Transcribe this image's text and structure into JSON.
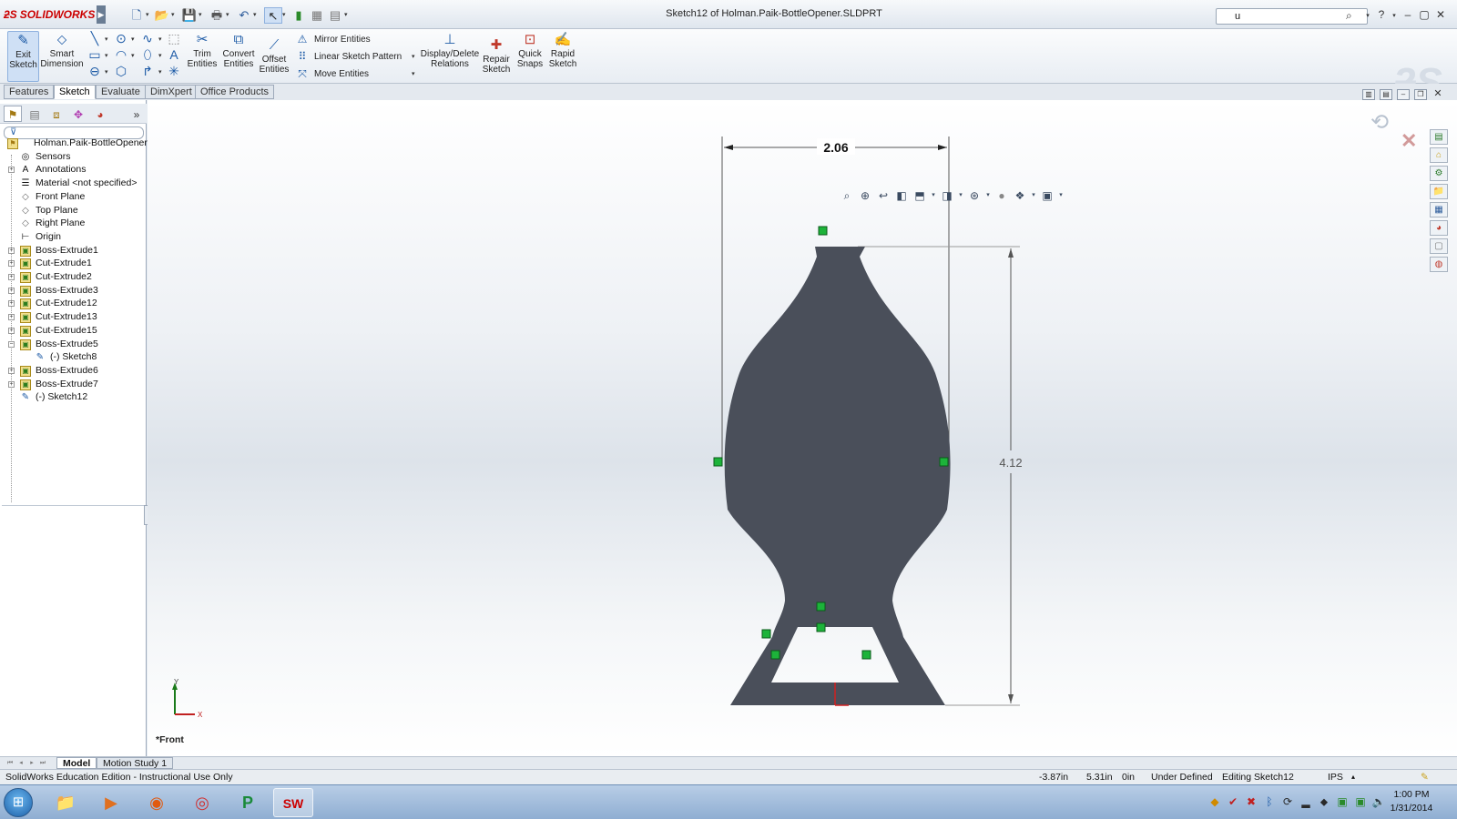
{
  "app": {
    "logo_text": "SOLIDWORKS",
    "doc_title": "Sketch12 of Holman.Paik-BottleOpener.SLDPRT",
    "search_value": "u"
  },
  "commands": {
    "exit_sketch": "Exit Sketch",
    "smart_dimension": "Smart Dimension",
    "trim_entities": "Trim Entities",
    "convert_entities": "Convert Entities",
    "offset_entities": "Offset Entities",
    "mirror_entities": "Mirror Entities",
    "linear_sketch_pattern": "Linear Sketch Pattern",
    "move_entities": "Move Entities",
    "display_delete_relations": "Display/Delete Relations",
    "repair_sketch": "Repair Sketch",
    "quick_snaps": "Quick Snaps",
    "rapid_sketch": "Rapid Sketch"
  },
  "tabs": [
    "Features",
    "Sketch",
    "Evaluate",
    "DimXpert",
    "Office Products"
  ],
  "active_tab": "Sketch",
  "tree": [
    {
      "label": "Holman.Paik-BottleOpener",
      "type": "part"
    },
    {
      "label": "Sensors",
      "type": "sensor"
    },
    {
      "label": "Annotations",
      "type": "annot"
    },
    {
      "label": "Material <not specified>",
      "type": "material"
    },
    {
      "label": "Front Plane",
      "type": "plane"
    },
    {
      "label": "Top Plane",
      "type": "plane"
    },
    {
      "label": "Right Plane",
      "type": "plane"
    },
    {
      "label": "Origin",
      "type": "origin"
    },
    {
      "label": "Boss-Extrude1",
      "type": "feat"
    },
    {
      "label": "Cut-Extrude1",
      "type": "feat"
    },
    {
      "label": "Cut-Extrude2",
      "type": "feat"
    },
    {
      "label": "Boss-Extrude3",
      "type": "feat"
    },
    {
      "label": "Cut-Extrude12",
      "type": "feat"
    },
    {
      "label": "Cut-Extrude13",
      "type": "feat"
    },
    {
      "label": "Cut-Extrude15",
      "type": "feat"
    },
    {
      "label": "Boss-Extrude5",
      "type": "feat"
    },
    {
      "label": "(-) Sketch8",
      "type": "sketch"
    },
    {
      "label": "Boss-Extrude6",
      "type": "feat"
    },
    {
      "label": "Boss-Extrude7",
      "type": "feat"
    },
    {
      "label": "(-) Sketch12",
      "type": "sketch"
    }
  ],
  "sketch": {
    "dim_width": "2.06",
    "dim_height": "4.12",
    "view_label": "*Front",
    "axis_y": "Y",
    "axis_x": "X",
    "fill_color": "#4a4f5a",
    "relation_color": "#1db33a"
  },
  "model_tabs": [
    "Model",
    "Motion Study 1"
  ],
  "status": {
    "edition": "SolidWorks Education Edition - Instructional Use Only",
    "x": "-3.87in",
    "y": "5.31in",
    "z": "0in",
    "state": "Under Defined",
    "editing": "Editing Sketch12",
    "units": "IPS"
  },
  "taskbar": {
    "time": "1:00 PM",
    "date": "1/31/2014"
  }
}
